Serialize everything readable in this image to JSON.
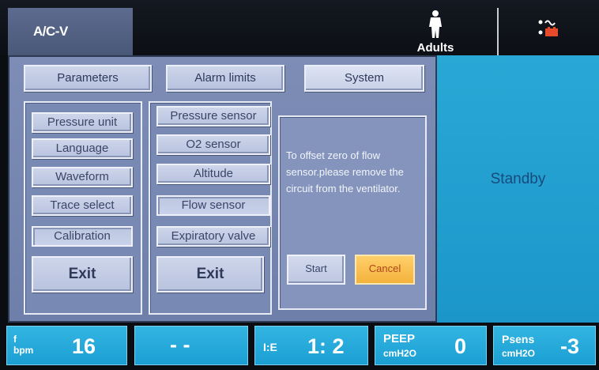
{
  "header": {
    "mode": "A/C-V",
    "patient_type": "Adults",
    "power_icon": "ac-battery-icon",
    "patient_icon": "adult-person-icon"
  },
  "tabs": [
    {
      "label": "Parameters"
    },
    {
      "label": "Alarm limits"
    },
    {
      "label": "System"
    }
  ],
  "left_menu": {
    "items": [
      "Pressure unit",
      "Language",
      "Waveform",
      "Trace select",
      "Calibration"
    ],
    "exit": "Exit"
  },
  "calibration_menu": {
    "items": [
      "Pressure sensor",
      "O2 sensor",
      "Altitude",
      "Flow sensor",
      "Expiratory valve"
    ],
    "exit": "Exit"
  },
  "dialog": {
    "message": "To offset zero of flow sensor.please remove the circuit from the ventilator.",
    "start": "Start",
    "cancel": "Cancel"
  },
  "status": {
    "text": "Standby"
  },
  "bottom_params": [
    {
      "label": "f",
      "unit": "bpm",
      "value": "16"
    },
    {
      "label": "",
      "unit": "",
      "value": "- -"
    },
    {
      "label": "I:E",
      "unit": "",
      "value": "1: 2"
    },
    {
      "label": "PEEP",
      "unit": "cmH2O",
      "value": "0"
    },
    {
      "label": "Psens",
      "unit": "cmH2O",
      "value": "-3"
    }
  ],
  "colors": {
    "panel": "#7d8db6",
    "status_panel": "#29a8d6",
    "param_cell": "#33b5e2",
    "cancel": "#f4b23c"
  }
}
